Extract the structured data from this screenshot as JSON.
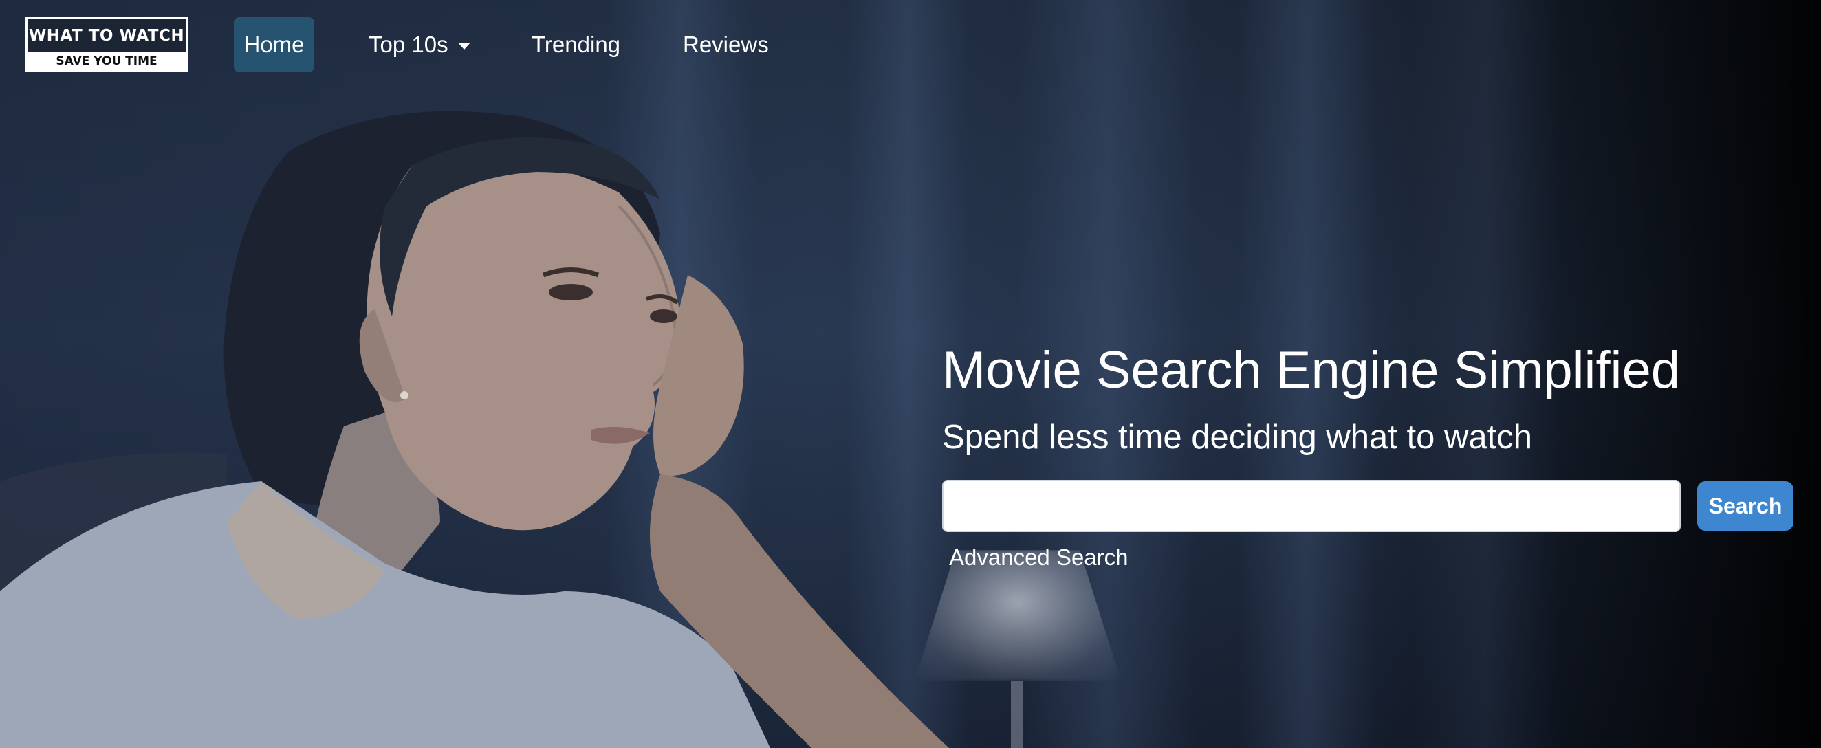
{
  "logo": {
    "title": "WHAT TO WATCH",
    "tagline": "SAVE YOU TIME"
  },
  "nav": {
    "items": [
      {
        "label": "Home",
        "active": true
      },
      {
        "label": "Top 10s",
        "has_dropdown": true
      },
      {
        "label": "Trending"
      },
      {
        "label": "Reviews"
      }
    ]
  },
  "hero": {
    "headline": "Movie Search Engine Simplified",
    "subhead": "Spend less time deciding what to watch",
    "search": {
      "value": "",
      "placeholder": "",
      "button_label": "Search"
    },
    "advanced_link": "Advanced Search"
  },
  "colors": {
    "accent": "#3f86d0",
    "active_nav": "#285a78",
    "background": "#243247"
  },
  "icons": {
    "dropdown": "caret-down-icon"
  }
}
